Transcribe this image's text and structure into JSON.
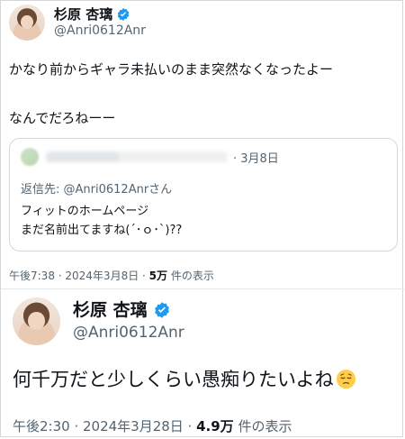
{
  "tweet1": {
    "display_name": "杉原 杏璃",
    "handle": "@Anri0612Anr",
    "line1": "かなり前からギャラ未払いのまま突然なくなったよー",
    "line2": "なんでだろねーー",
    "quote": {
      "date": "· 3月8日",
      "reply_prefix": "返信先:",
      "reply_handle": "@Anri0612Anrさん",
      "text_line1": "フィットのホームページ",
      "text_line2": "まだ名前出てますね(´･ｏ･`)??"
    },
    "time_date": "午後7:38 · 2024年3月8日 · ",
    "views_count": "5万",
    "views_suffix": " 件の表示"
  },
  "tweet2": {
    "display_name": "杉原 杏璃",
    "handle": "@Anri0612Anr",
    "text": "何千万だと少しくらい愚痴りたいよね",
    "emoji_name": "pensive-face-emoji",
    "time_date": "午後2:30 · 2024年3月28日 · ",
    "views_count": "4.9万",
    "views_suffix": " 件の表示"
  },
  "colors": {
    "verified_blue": "#1d9bf0",
    "secondary_text": "#536471",
    "primary_text": "#0f1419",
    "border": "#cfd9de"
  }
}
